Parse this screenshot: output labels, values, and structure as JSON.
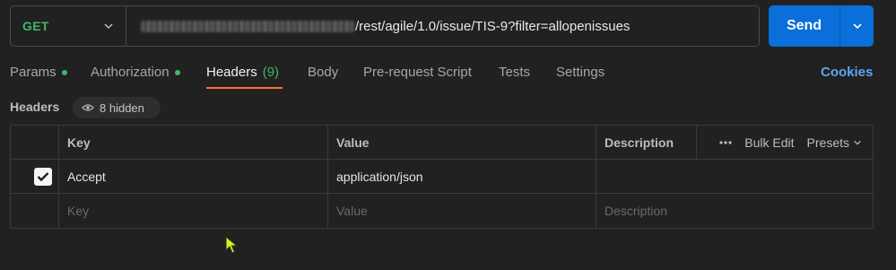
{
  "request": {
    "method": "GET",
    "url_visible": "/rest/agile/1.0/issue/TIS-9?filter=allopenissues",
    "send_label": "Send"
  },
  "tabs": [
    {
      "label": "Params",
      "indicator": true
    },
    {
      "label": "Authorization",
      "indicator": true
    },
    {
      "label": "Headers",
      "count": "(9)",
      "active": true
    },
    {
      "label": "Body"
    },
    {
      "label": "Pre-request Script"
    },
    {
      "label": "Tests"
    },
    {
      "label": "Settings"
    }
  ],
  "cookies_label": "Cookies",
  "headers_section": {
    "title": "Headers",
    "hidden_label": "8 hidden"
  },
  "table": {
    "columns": {
      "key": "Key",
      "value": "Value",
      "description": "Description"
    },
    "actions": {
      "bulk_edit": "Bulk Edit",
      "presets": "Presets"
    },
    "rows": [
      {
        "checked": true,
        "key": "Accept",
        "value": "application/json",
        "description": ""
      }
    ],
    "placeholders": {
      "key": "Key",
      "value": "Value",
      "description": "Description"
    }
  },
  "colors": {
    "accent_send": "#0a6fd8",
    "method_green": "#3fb86b",
    "tab_underline": "#ff6c37",
    "cookies_blue": "#5aa7f5"
  }
}
